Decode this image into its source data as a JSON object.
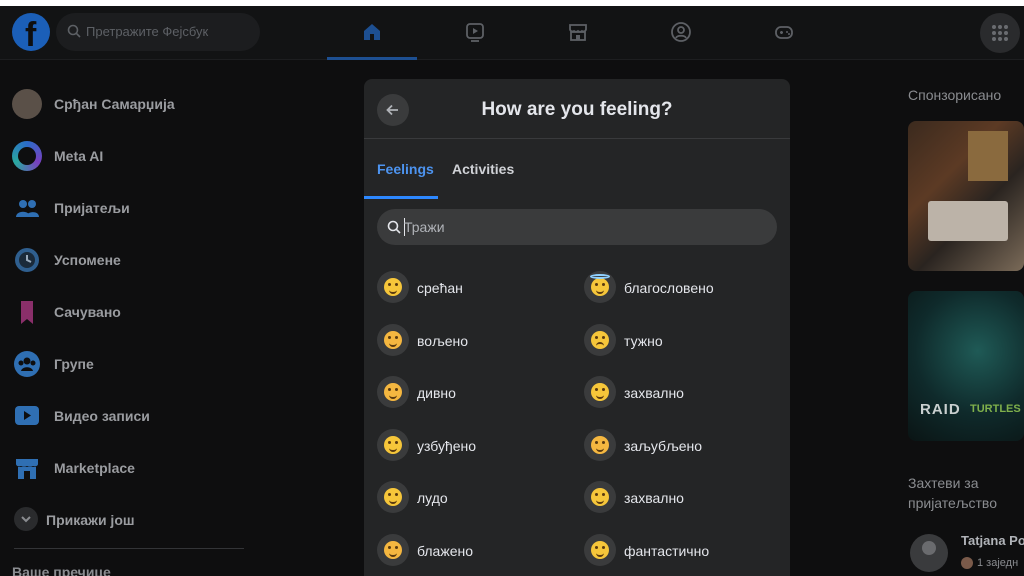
{
  "header": {
    "search_placeholder": "Претражите Фејсбук",
    "nav": [
      "home",
      "video",
      "marketplace",
      "groups",
      "gaming"
    ]
  },
  "sidebar": {
    "items": [
      {
        "label": "Срђан Самарџија",
        "icon": "profile-avatar"
      },
      {
        "label": "Meta AI",
        "icon": "meta-ai-icon"
      },
      {
        "label": "Пријатељи",
        "icon": "friends-icon"
      },
      {
        "label": "Успомене",
        "icon": "memories-icon"
      },
      {
        "label": "Сачувано",
        "icon": "saved-icon"
      },
      {
        "label": "Групе",
        "icon": "groups-icon"
      },
      {
        "label": "Видео записи",
        "icon": "video-icon"
      },
      {
        "label": "Marketplace",
        "icon": "marketplace-icon"
      }
    ],
    "show_more": "Прикажи још",
    "bottom_cut_text": "Ваше пречице"
  },
  "right": {
    "sponsored": "Спонзорисано",
    "ad2_title": "RAID",
    "ad2_subtitle": "TURTLES",
    "friend_requests_title": "Захтеви за пријатељство",
    "request_name": "Tatjana Po",
    "request_mutual": "1 заједн"
  },
  "modal": {
    "title": "How are you feeling?",
    "tabs": [
      "Feelings",
      "Activities"
    ],
    "search_placeholder": "Тражи",
    "feelings": [
      {
        "label": "срећан",
        "emoji": "smile"
      },
      {
        "label": "благословено",
        "emoji": "halo"
      },
      {
        "label": "вољено",
        "emoji": "wink-heart"
      },
      {
        "label": "тужно",
        "emoji": "sad"
      },
      {
        "label": "дивно",
        "emoji": "wink"
      },
      {
        "label": "захвално",
        "emoji": "smile"
      },
      {
        "label": "узбуђено",
        "emoji": "grin"
      },
      {
        "label": "заљубљено",
        "emoji": "wink-heart"
      },
      {
        "label": "лудо",
        "emoji": "tongue"
      },
      {
        "label": "захвално",
        "emoji": "surprised"
      },
      {
        "label": "блажено",
        "emoji": "blush"
      },
      {
        "label": "фантастично",
        "emoji": "grin"
      }
    ]
  },
  "colors": {
    "accent": "#2d88ff",
    "modal_bg": "#242526",
    "page_bg": "#0e0e0f"
  }
}
